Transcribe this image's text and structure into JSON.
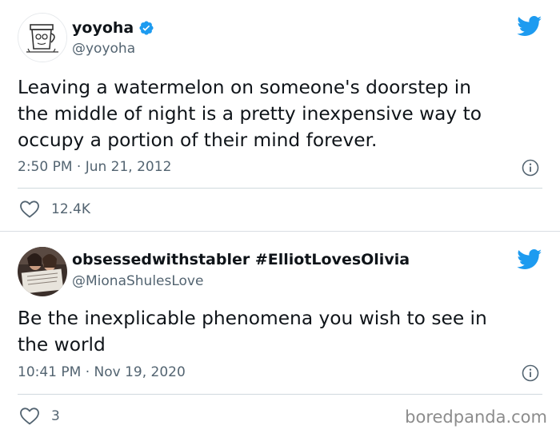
{
  "tweets": [
    {
      "display_name": "yoyoha",
      "verified": true,
      "handle": "@yoyoha",
      "text": "Leaving a watermelon on someone's doorstep in\nthe middle of night is a pretty inexpensive way to\noccupy a portion of their mind forever.",
      "timestamp": "2:50 PM · Jun 21, 2012",
      "likes": "12.4K"
    },
    {
      "display_name": "obsessedwithstabler #ElliotLovesOlivia",
      "verified": false,
      "handle": "@MionaShulesLove",
      "text": "Be the inexplicable phenomena you wish to see in\nthe world",
      "timestamp": "10:41 PM · Nov 19, 2020",
      "likes": "3"
    }
  ],
  "watermark": "boredpanda.com",
  "colors": {
    "twitter_blue": "#1d9bf0",
    "secondary_text": "#536471",
    "primary_text": "#0f1419",
    "divider": "#cfd9de"
  },
  "icons": {
    "brand": "twitter-bird-icon",
    "verified": "verified-badge-icon",
    "info": "info-icon",
    "like": "heart-icon"
  }
}
